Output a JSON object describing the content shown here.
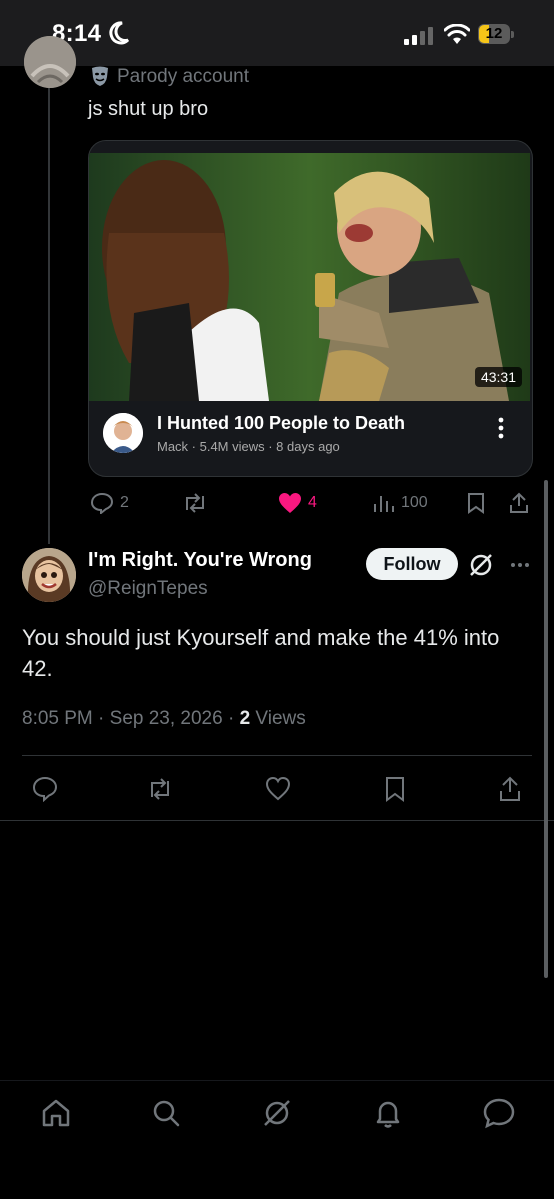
{
  "status_bar": {
    "time": "8:14",
    "battery": "12"
  },
  "parent_tweet": {
    "badge_label": "Parody account",
    "text": "js shut up bro",
    "card": {
      "duration": "43:31",
      "title": "I Hunted 100 People to Death",
      "meta": "Mack · 5.4M views · 8 days ago"
    },
    "actions": {
      "replies": "2",
      "likes": "4",
      "views": "100"
    }
  },
  "tweet": {
    "author_name": "I'm Right. You're Wrong",
    "author_handle": "@ReignTepes",
    "follow_label": "Follow",
    "body": "You should just Kyourself and make the 41% into 42.",
    "timestamp": "8:05 PM · Sep 23, 2026 · ",
    "views_count": "2",
    "views_label": " Views"
  },
  "colors": {
    "background": "#000000",
    "like_active": "#f91880",
    "muted": "#71767b",
    "text": "#e7e9ea"
  }
}
